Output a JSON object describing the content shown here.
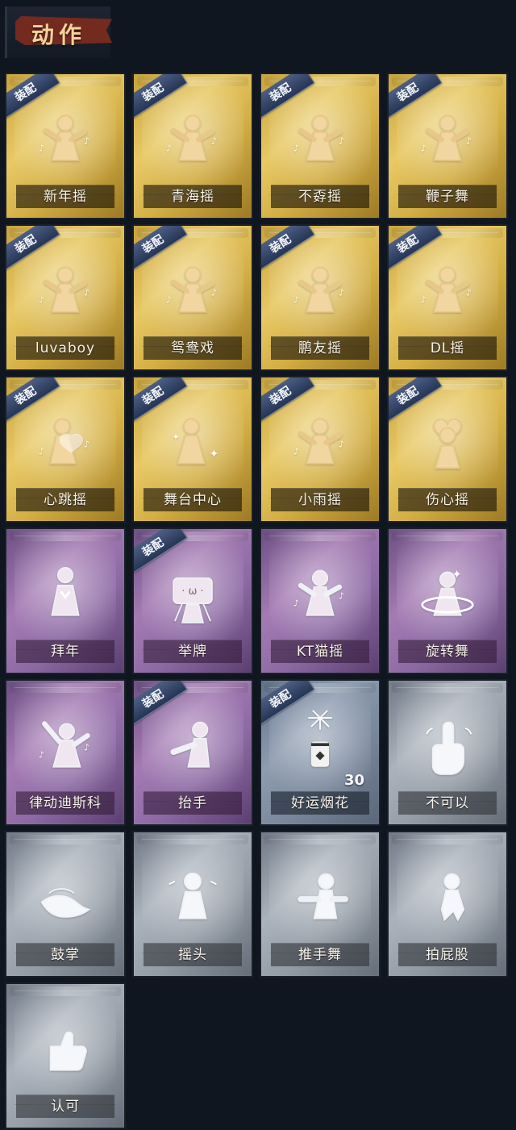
{
  "header": {
    "title": "动作"
  },
  "equip_badge": "装配",
  "cards": [
    {
      "label": "新年摇",
      "theme": "gold",
      "equipped": true,
      "icon": "pose-dance-icon"
    },
    {
      "label": "青海摇",
      "theme": "gold",
      "equipped": true,
      "icon": "pose-dance-icon"
    },
    {
      "label": "不孬摇",
      "theme": "gold",
      "equipped": true,
      "icon": "pose-dance-icon"
    },
    {
      "label": "鞭子舞",
      "theme": "gold",
      "equipped": true,
      "icon": "pose-dance-icon"
    },
    {
      "label": "luvaboy",
      "theme": "gold",
      "equipped": true,
      "icon": "pose-dance-icon"
    },
    {
      "label": "鸳鸯戏",
      "theme": "gold",
      "equipped": true,
      "icon": "pose-dance-icon"
    },
    {
      "label": "鹏友摇",
      "theme": "gold",
      "equipped": true,
      "icon": "pose-dance-icon"
    },
    {
      "label": "DL摇",
      "theme": "gold",
      "equipped": true,
      "icon": "pose-dance-icon"
    },
    {
      "label": "心跳摇",
      "theme": "gold",
      "equipped": true,
      "icon": "pose-heart-icon"
    },
    {
      "label": "舞台中心",
      "theme": "gold",
      "equipped": true,
      "icon": "pose-sparkle-icon"
    },
    {
      "label": "小雨摇",
      "theme": "gold",
      "equipped": true,
      "icon": "pose-dance-icon"
    },
    {
      "label": "伤心摇",
      "theme": "gold",
      "equipped": true,
      "icon": "pose-heart-hands-icon"
    },
    {
      "label": "拜年",
      "theme": "purple",
      "equipped": false,
      "icon": "pose-bow-icon"
    },
    {
      "label": "举牌",
      "theme": "purple",
      "equipped": true,
      "icon": "pose-sign-icon"
    },
    {
      "label": "KT猫摇",
      "theme": "purple",
      "equipped": false,
      "icon": "pose-dance-icon"
    },
    {
      "label": "旋转舞",
      "theme": "purple",
      "equipped": false,
      "icon": "pose-spin-icon"
    },
    {
      "label": "律动迪斯科",
      "theme": "purple",
      "equipped": false,
      "icon": "pose-disco-icon"
    },
    {
      "label": "抬手",
      "theme": "purple",
      "equipped": true,
      "icon": "pose-raise-hand-icon"
    },
    {
      "label": "好运烟花",
      "theme": "blue",
      "equipped": true,
      "icon": "firework-icon",
      "count": "30"
    },
    {
      "label": "不可以",
      "theme": "gray",
      "equipped": false,
      "icon": "finger-wave-icon"
    },
    {
      "label": "鼓掌",
      "theme": "gray",
      "equipped": false,
      "icon": "clap-icon"
    },
    {
      "label": "摇头",
      "theme": "gray",
      "equipped": false,
      "icon": "shake-head-icon"
    },
    {
      "label": "推手舞",
      "theme": "gray",
      "equipped": false,
      "icon": "push-dance-icon"
    },
    {
      "label": "拍屁股",
      "theme": "gray",
      "equipped": false,
      "icon": "spank-icon"
    },
    {
      "label": "认可",
      "theme": "gray",
      "equipped": false,
      "icon": "thumbs-up-icon"
    }
  ],
  "colors": {
    "gold": "#d8b24c",
    "purple": "#9a74b0",
    "blue": "#7d8ca2",
    "gray": "#9aa2ac",
    "label_text": "#f7f3ea",
    "badge": "#33466b"
  }
}
